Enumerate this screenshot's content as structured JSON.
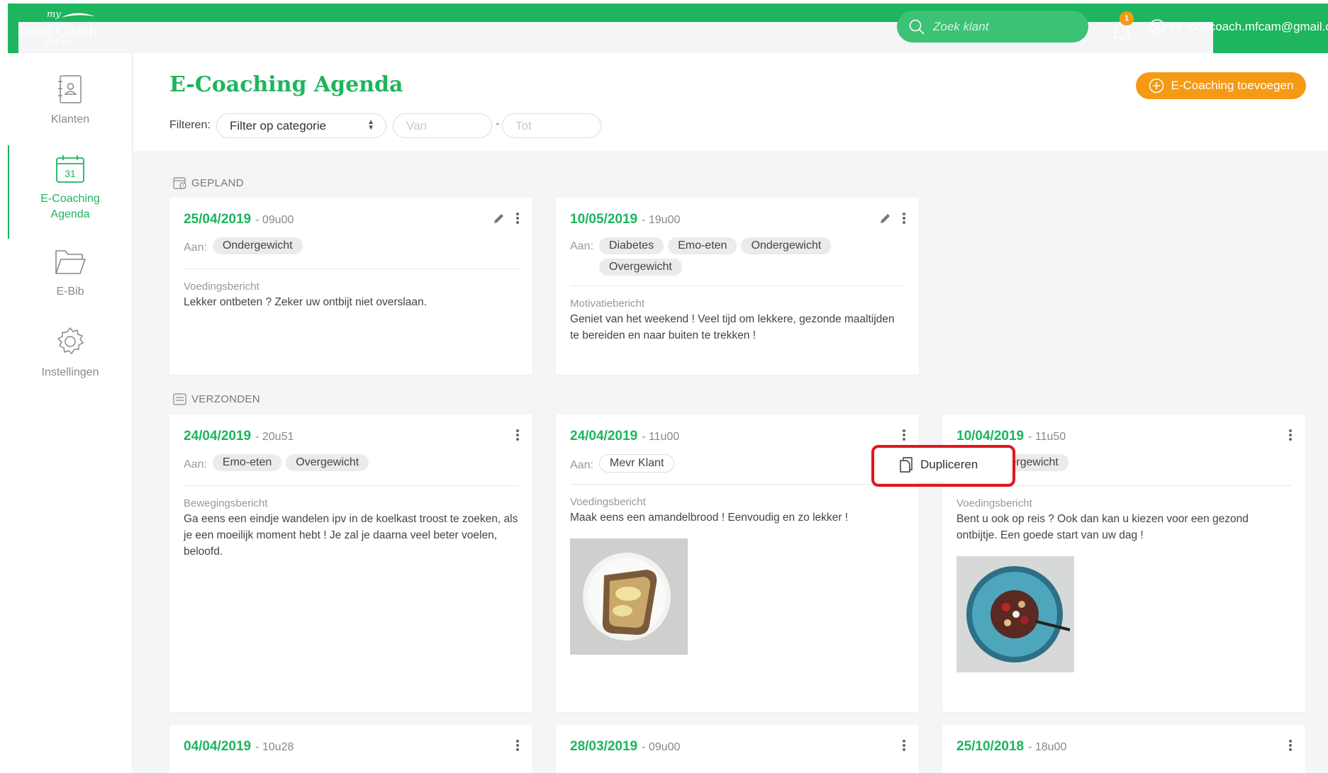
{
  "app": {
    "logo_my": "my",
    "logo_main": "Food Coach",
    "logo_andme": "and me"
  },
  "topbar": {
    "search_placeholder": "Zoek klant",
    "notification_count": "1",
    "user_email": "de.foodcoach.mfcam@gmail.com"
  },
  "sidebar": {
    "items": [
      {
        "label": "Klanten",
        "icon": "contacts-book-icon",
        "active": false
      },
      {
        "label": "E-Coaching Agenda",
        "icon": "calendar-icon",
        "active": true
      },
      {
        "label": "E-Bib",
        "icon": "folder-icon",
        "active": false
      },
      {
        "label": "Instellingen",
        "icon": "gear-icon",
        "active": false
      }
    ]
  },
  "header": {
    "title": "E-Coaching Agenda",
    "add_button": "E-Coaching toevoegen",
    "filter_label": "Filteren:",
    "category_select": "Filter op categorie",
    "from_placeholder": "Van",
    "to_placeholder": "Tot",
    "separator": "-"
  },
  "sections": {
    "planned": "GEPLAND",
    "sent": "VERZONDEN"
  },
  "to_label": "Aan:",
  "planned_cards": [
    {
      "date": "25/04/2019",
      "time": "- 09u00",
      "recipients": [
        "Ondergewicht"
      ],
      "kind": "Voedingsbericht",
      "message": "Lekker ontbeten ? Zeker uw ontbijt niet overslaan."
    },
    {
      "date": "10/05/2019",
      "time": "- 19u00",
      "recipients": [
        "Diabetes",
        "Emo-eten",
        "Ondergewicht",
        "Overgewicht"
      ],
      "kind": "Motivatiebericht",
      "message": "Geniet van het weekend ! Veel tijd om lekkere, gezonde maaltijden te bereiden en naar buiten te trekken !"
    }
  ],
  "sent_cards": [
    {
      "date": "24/04/2019",
      "time": "- 20u51",
      "recipients": [
        "Emo-eten",
        "Overgewicht"
      ],
      "kind": "Bewegingsbericht",
      "message": "Ga eens een eindje wandelen ipv in de koelkast troost te zoeken, als je een moeilijk moment hebt ! Je zal je daarna veel beter voelen, beloofd."
    },
    {
      "date": "24/04/2019",
      "time": "- 11u00",
      "recipients": [
        "Mevr Klant"
      ],
      "kind": "Voedingsbericht",
      "message": "Maak eens een amandelbrood ! Eenvoudig en zo lekker !",
      "image": "almond-bread-photo"
    },
    {
      "date": "10/04/2019",
      "time": "- 11u50",
      "recipients": [
        "Overgewicht"
      ],
      "kind": "Voedingsbericht",
      "message": "Bent u ook op reis ? Ook dan kan u kiezen voor een gezond ontbijtje. Een goede start van uw dag !",
      "image": "breakfast-bowl-photo"
    }
  ],
  "more_cards": [
    {
      "date": "04/04/2019",
      "time": "- 10u28"
    },
    {
      "date": "28/03/2019",
      "time": "- 09u00"
    },
    {
      "date": "25/10/2018",
      "time": "- 18u00"
    }
  ],
  "context_menu": {
    "duplicate": "Dupliceren"
  },
  "colors": {
    "brand_green": "#1db55d",
    "accent_orange": "#f49a14",
    "highlight_red": "#e0161e"
  }
}
